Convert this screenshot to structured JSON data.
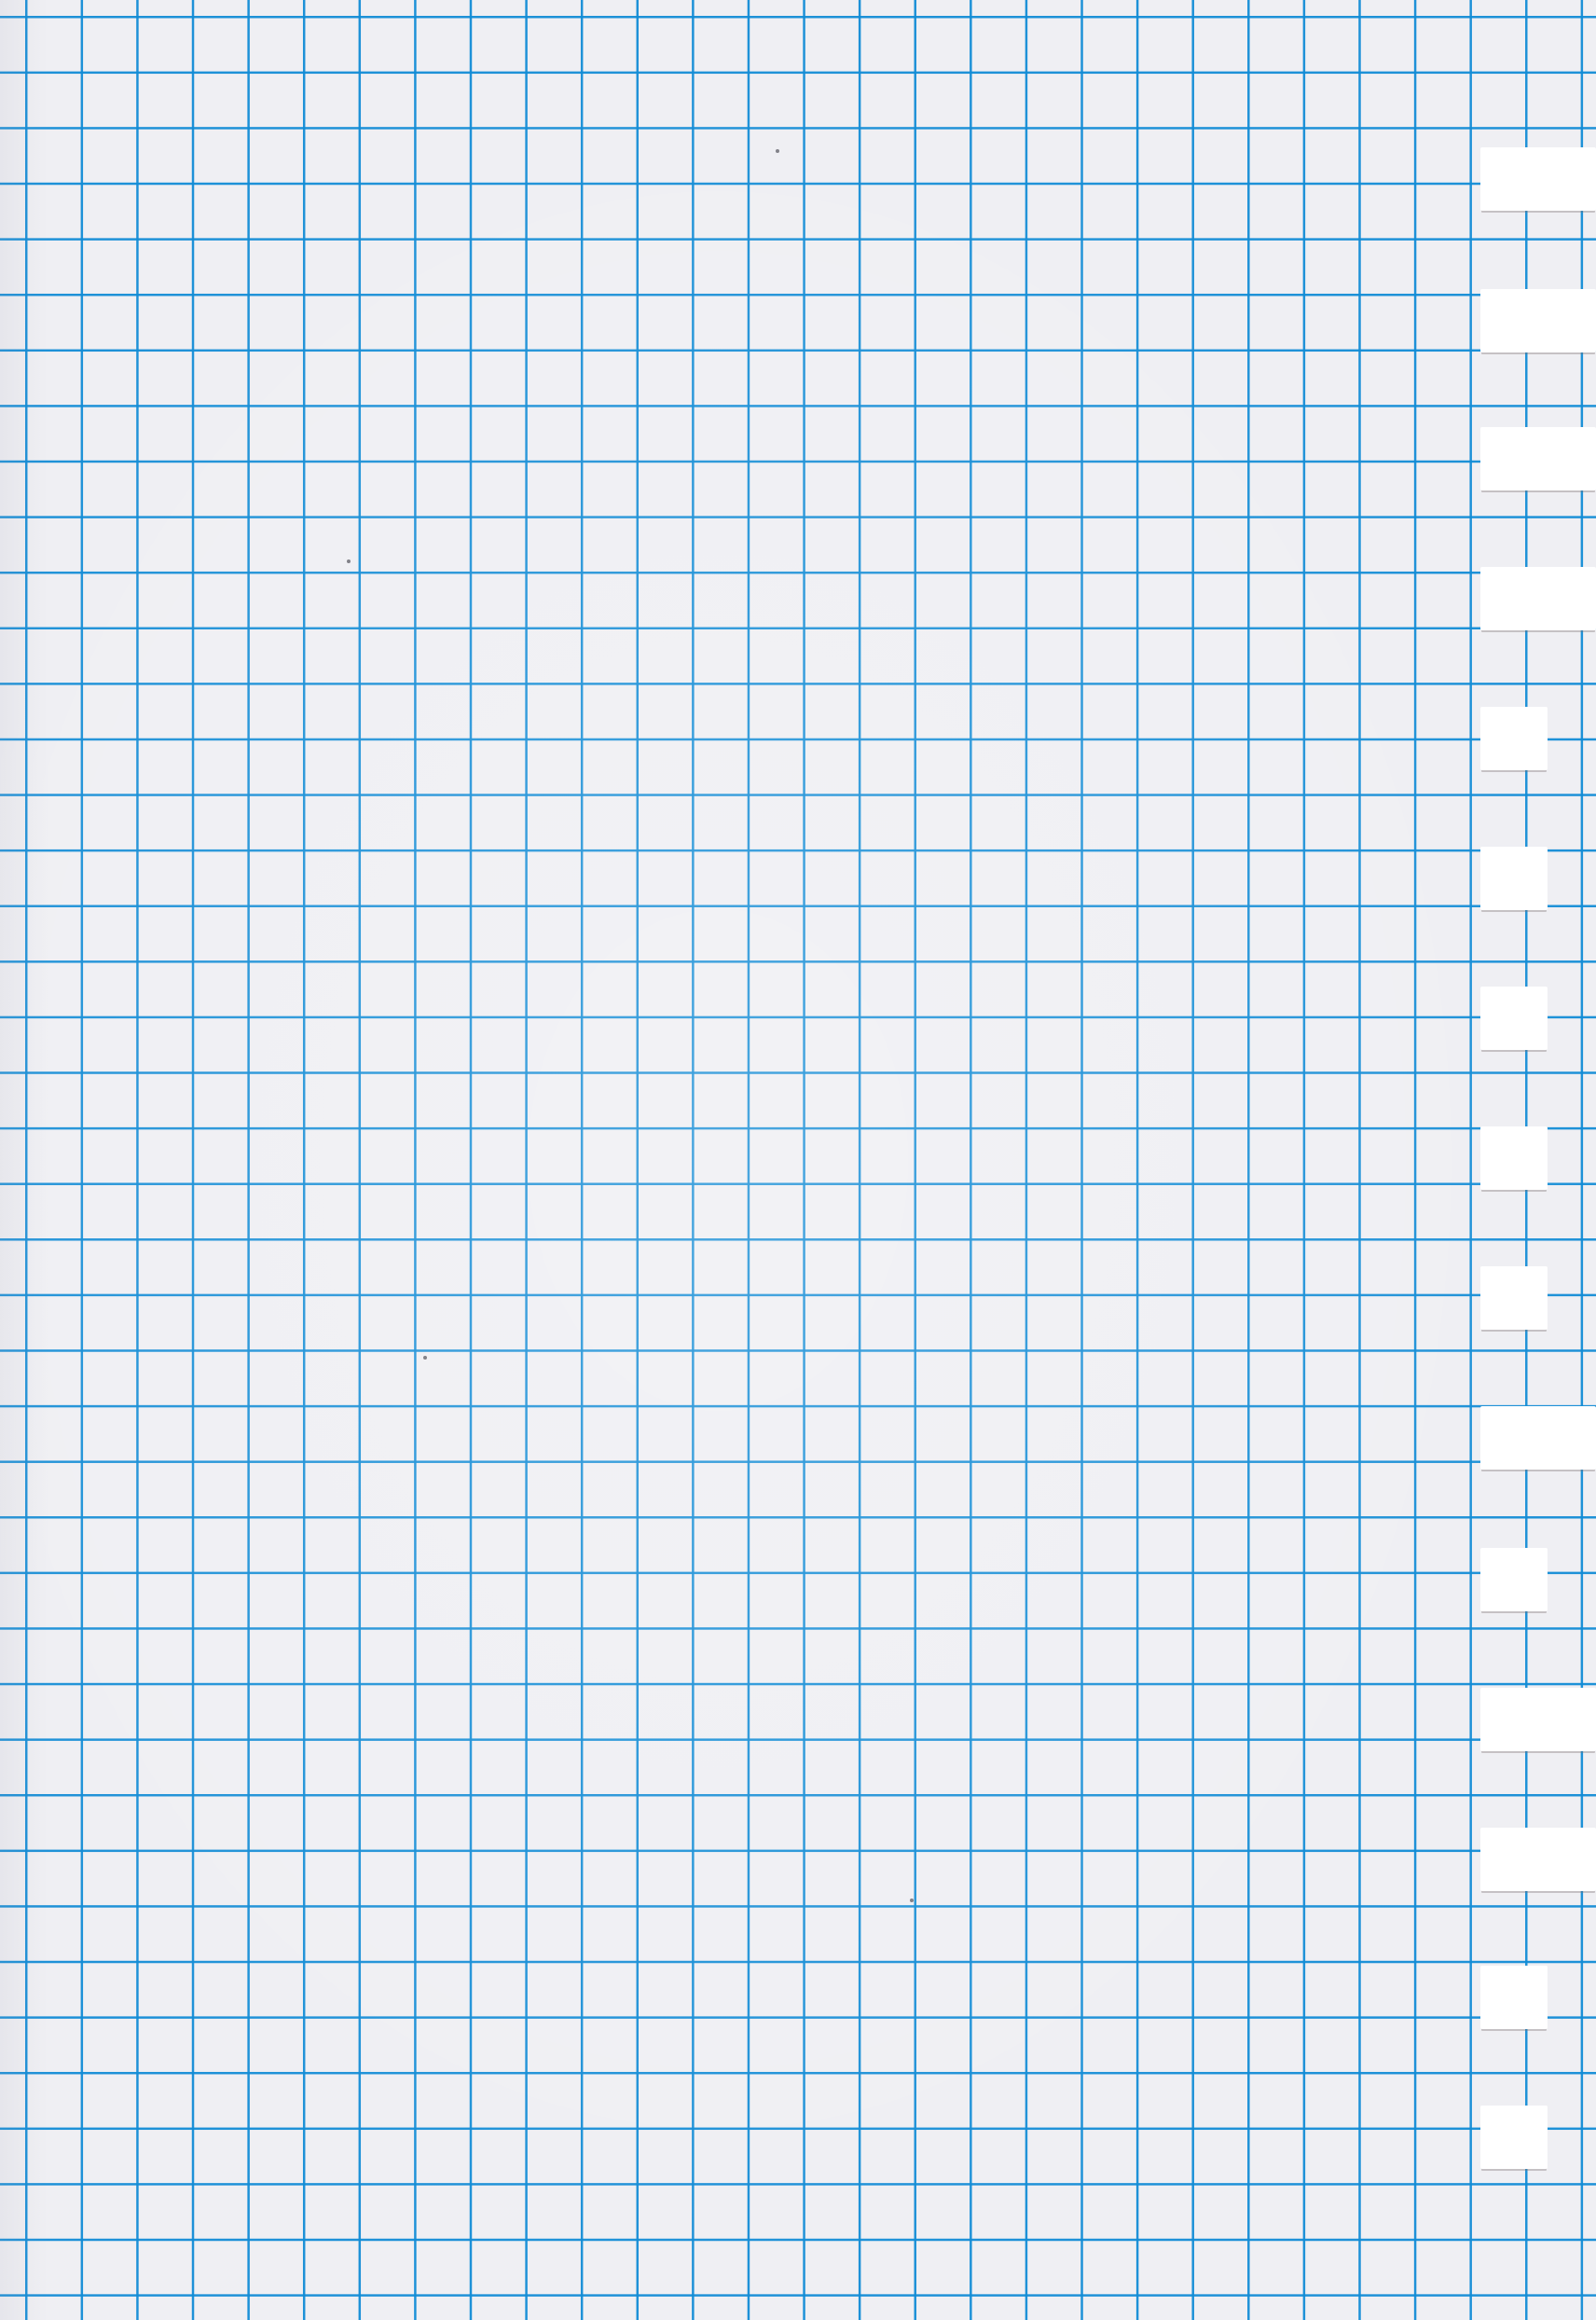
{
  "image": {
    "subject": "graph-paper-sheet",
    "paper_color": "#efeff3",
    "grid_color": "#128cd6",
    "tab_color": "#ffffff"
  }
}
